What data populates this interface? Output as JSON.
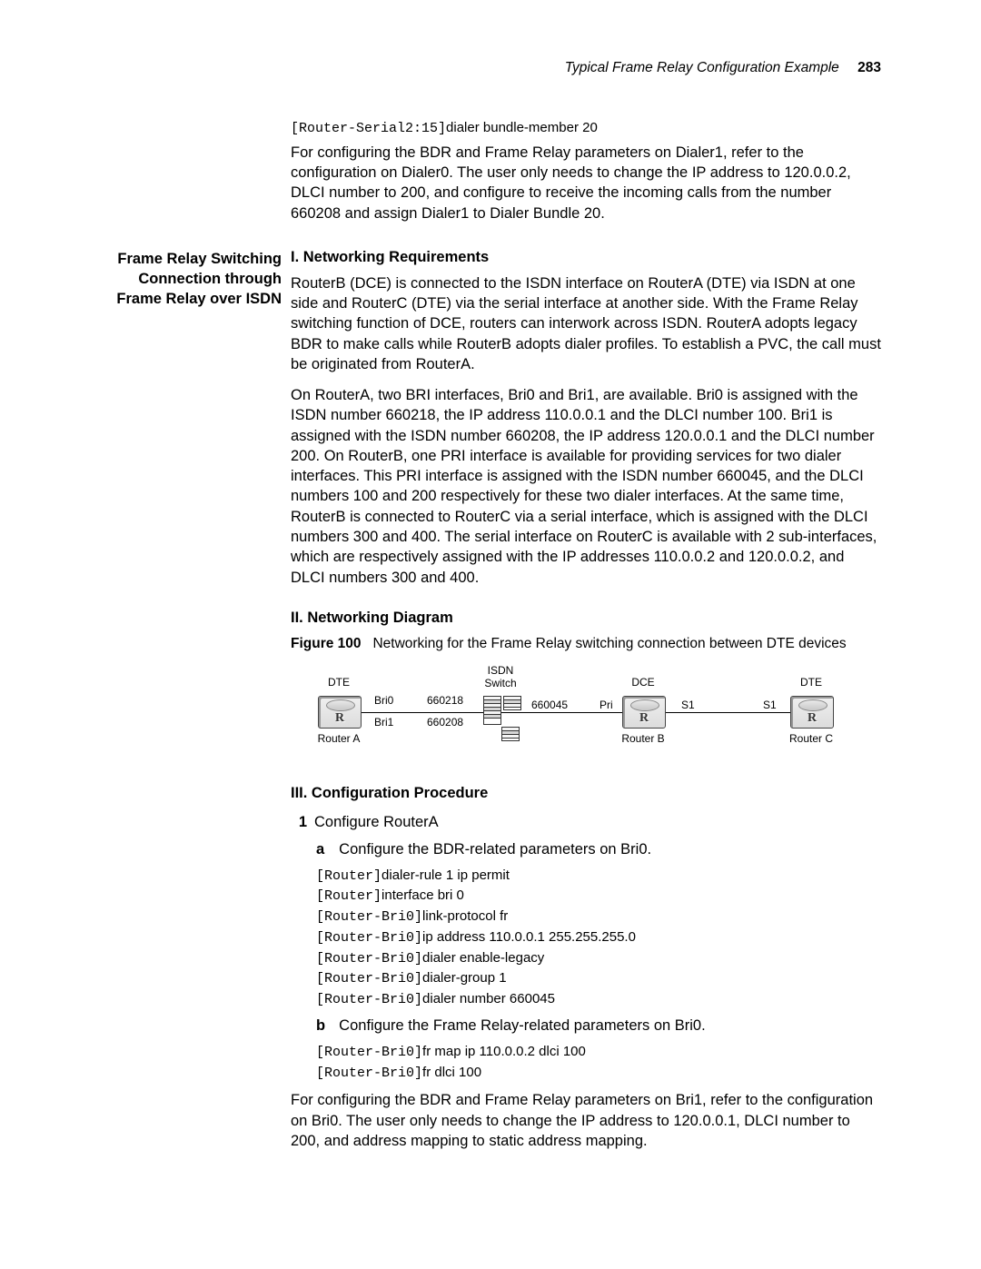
{
  "header": {
    "title": "Typical Frame Relay Configuration Example",
    "page": "283"
  },
  "intro_code": {
    "prompt": "[Router-Serial2:15]",
    "cmd": "dialer bundle-member 20"
  },
  "intro_para": "For configuring the BDR and Frame Relay parameters on Dialer1, refer to the configuration on Dialer0. The user only needs to change the IP address to 120.0.0.2, DLCI number to 200, and configure to receive the incoming calls from the number 660208 and assign Dialer1 to Dialer Bundle 20.",
  "side_heading": "Frame Relay Switching Connection through Frame Relay over ISDN",
  "s1_title": "I. Networking Requirements",
  "s1_p1": "RouterB (DCE) is connected to the ISDN interface on RouterA (DTE) via ISDN at one side and RouterC (DTE) via the serial interface at another side. With the Frame Relay switching function of DCE, routers can interwork across ISDN. RouterA adopts legacy BDR to make calls while RouterB adopts dialer profiles. To establish a PVC, the call must be originated from RouterA.",
  "s1_p2": "On RouterA, two BRI interfaces, Bri0 and Bri1, are available. Bri0 is assigned with the ISDN number 660218, the IP address 110.0.0.1 and the DLCI number 100. Bri1 is assigned with the ISDN number 660208, the IP address 120.0.0.1 and the DLCI number 200. On RouterB, one PRI interface is available for providing services for two dialer interfaces. This PRI interface is assigned with the ISDN number 660045, and the DLCI numbers 100 and 200 respectively for these two dialer interfaces. At the same time, RouterB is connected to RouterC via a serial interface, which is assigned with the DLCI numbers 300 and 400. The serial interface on RouterC is available with 2 sub-interfaces, which are respectively assigned with the IP addresses 110.0.0.2 and 120.0.0.2, and DLCI numbers 300 and 400.",
  "s2_title": "II. Networking Diagram",
  "fig_no": "Figure 100",
  "fig_caption": "Networking for the Frame Relay switching connection between DTE devices",
  "diagram": {
    "routerA": {
      "role": "DTE",
      "name": "Router A",
      "bri0": "Bri0",
      "bri1": "Bri1",
      "num0": "660218",
      "num1": "660208"
    },
    "switch": {
      "role": "ISDN\nSwitch",
      "num": "660045"
    },
    "routerB": {
      "role": "DCE",
      "name": "Router B",
      "pri": "Pri",
      "s1": "S1"
    },
    "routerC": {
      "role": "DTE",
      "name": "Router C",
      "s1": "S1"
    }
  },
  "s3_title": "III. Configuration Procedure",
  "step1_no": "1",
  "step1_text": "Configure RouterA",
  "step1a_let": "a",
  "step1a_text": "Configure the BDR-related parameters on Bri0.",
  "step1a_code": [
    {
      "prompt": "[Router]",
      "cmd": "dialer-rule 1 ip permit"
    },
    {
      "prompt": "[Router]",
      "cmd": "interface bri 0"
    },
    {
      "prompt": "[Router-Bri0]",
      "cmd": "link-protocol fr"
    },
    {
      "prompt": "[Router-Bri0]",
      "cmd": "ip address 110.0.0.1 255.255.255.0"
    },
    {
      "prompt": "[Router-Bri0]",
      "cmd": "dialer enable-legacy"
    },
    {
      "prompt": "[Router-Bri0]",
      "cmd": "dialer-group 1"
    },
    {
      "prompt": "[Router-Bri0]",
      "cmd": "dialer number 660045"
    }
  ],
  "step1b_let": "b",
  "step1b_text": "Configure the Frame Relay-related parameters on Bri0.",
  "step1b_code": [
    {
      "prompt": "[Router-Bri0]",
      "cmd": "fr map ip 110.0.0.2 dlci 100"
    },
    {
      "prompt": "[Router-Bri0]",
      "cmd": "fr dlci 100"
    }
  ],
  "tail_para": "For configuring the BDR and Frame Relay parameters on Bri1, refer to the configuration on Bri0. The user only needs to change the IP address to 120.0.0.1, DLCI number to 200, and address mapping to static address mapping."
}
